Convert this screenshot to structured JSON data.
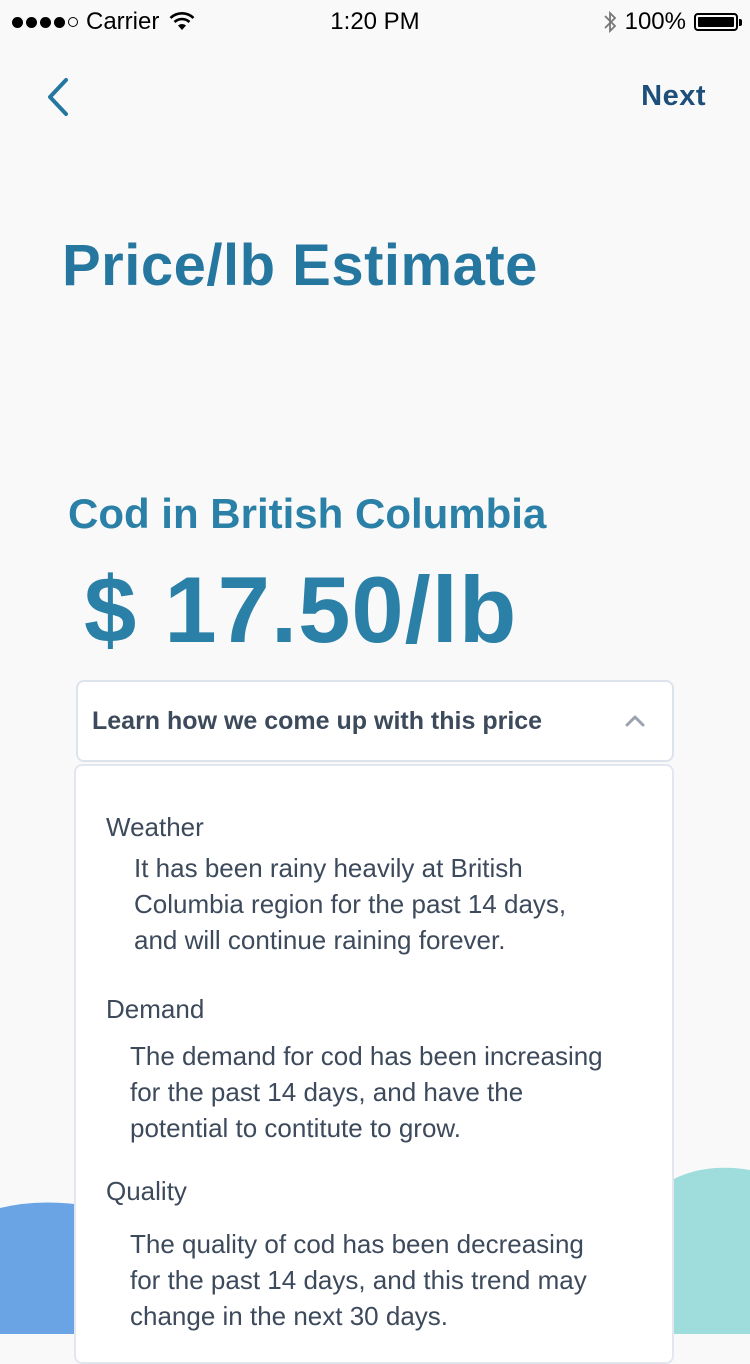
{
  "status_bar": {
    "carrier": "Carrier",
    "time": "1:20 PM",
    "battery": "100%"
  },
  "nav": {
    "back_icon": "chevron-left-icon",
    "next_label": "Next"
  },
  "page": {
    "title": "Price/lb Estimate",
    "subtitle": "Cod in British Columbia",
    "price": "$ 17.50/lb"
  },
  "accordion": {
    "header_label": "Learn how we come up with this price",
    "expanded": true,
    "sections": [
      {
        "title": "Weather",
        "lines": [
          "It has been rainy heavily at British",
          "Columbia region for the past 14 days,",
          "and will continue raining forever."
        ]
      },
      {
        "title": "Demand",
        "lines": [
          "The demand for cod has been increasing",
          "for the past 14 days, and have the",
          "potential to contitute to grow."
        ]
      },
      {
        "title": "Quality",
        "lines": [
          "The quality of cod has been decreasing",
          "for the past 14 days, and this trend may",
          "change in the next 30 days."
        ]
      }
    ]
  },
  "colors": {
    "title": "#2577a0",
    "price": "#2a80a6",
    "next": "#1d4f7a",
    "text": "#3d4a5c",
    "wave_left": "#6aa4e4",
    "wave_right": "#9fdcdc"
  }
}
